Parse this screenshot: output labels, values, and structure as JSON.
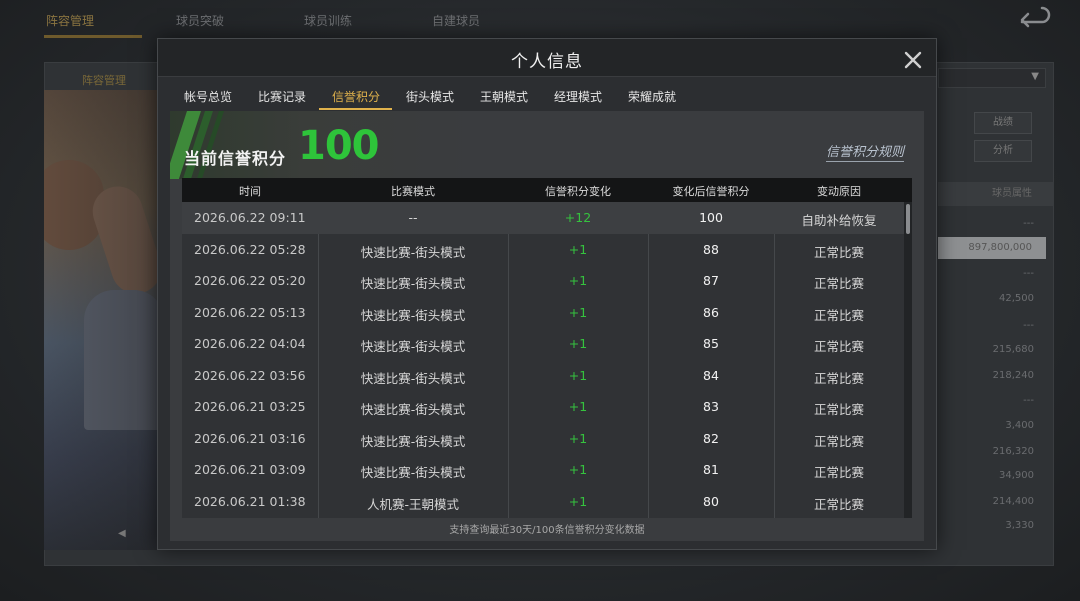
{
  "background": {
    "top_tabs": [
      "阵容管理",
      "球员突破",
      "球员训练",
      "自建球员"
    ],
    "right_buttons": [
      "战绩",
      "分析"
    ],
    "right_header": "球员属性",
    "right_highlight": "897,800,000",
    "right_values": [
      "---",
      "---",
      "42,500",
      "---",
      "215,680",
      "218,240",
      "---",
      "3,400",
      "216,320",
      "34,900",
      "214,400",
      "3,330"
    ]
  },
  "modal": {
    "title": "个人信息",
    "tabs": [
      "帐号总览",
      "比赛记录",
      "信誉积分",
      "街头模式",
      "王朝模式",
      "经理模式",
      "荣耀成就"
    ],
    "active_tab": "信誉积分"
  },
  "score": {
    "label": "当前信誉积分",
    "value": "100",
    "rules_link": "信誉积分规则"
  },
  "table": {
    "headers": [
      "时间",
      "比赛模式",
      "信誉积分变化",
      "变化后信誉积分",
      "变动原因"
    ],
    "rows": [
      {
        "time": "2026.06.22  09:11",
        "mode": "--",
        "change": "+12",
        "after": "100",
        "reason": "自助补给恢复"
      },
      {
        "time": "2026.06.22  05:28",
        "mode": "快速比赛-街头模式",
        "change": "+1",
        "after": "88",
        "reason": "正常比赛"
      },
      {
        "time": "2026.06.22  05:20",
        "mode": "快速比赛-街头模式",
        "change": "+1",
        "after": "87",
        "reason": "正常比赛"
      },
      {
        "time": "2026.06.22  05:13",
        "mode": "快速比赛-街头模式",
        "change": "+1",
        "after": "86",
        "reason": "正常比赛"
      },
      {
        "time": "2026.06.22  04:04",
        "mode": "快速比赛-街头模式",
        "change": "+1",
        "after": "85",
        "reason": "正常比赛"
      },
      {
        "time": "2026.06.22  03:56",
        "mode": "快速比赛-街头模式",
        "change": "+1",
        "after": "84",
        "reason": "正常比赛"
      },
      {
        "time": "2026.06.21  03:25",
        "mode": "快速比赛-街头模式",
        "change": "+1",
        "after": "83",
        "reason": "正常比赛"
      },
      {
        "time": "2026.06.21  03:16",
        "mode": "快速比赛-街头模式",
        "change": "+1",
        "after": "82",
        "reason": "正常比赛"
      },
      {
        "time": "2026.06.21  03:09",
        "mode": "快速比赛-街头模式",
        "change": "+1",
        "after": "81",
        "reason": "正常比赛"
      },
      {
        "time": "2026.06.21  01:38",
        "mode": "人机赛-王朝模式",
        "change": "+1",
        "after": "80",
        "reason": "正常比赛"
      }
    ],
    "footer_note": "支持查询最近30天/100条信誉积分变化数据"
  },
  "colors": {
    "accent_gold": "#e0b24c",
    "positive_green": "#35c23e",
    "score_green": "#2ec43a"
  },
  "icons": {
    "close": "close-icon",
    "back": "back-arrow-icon"
  }
}
